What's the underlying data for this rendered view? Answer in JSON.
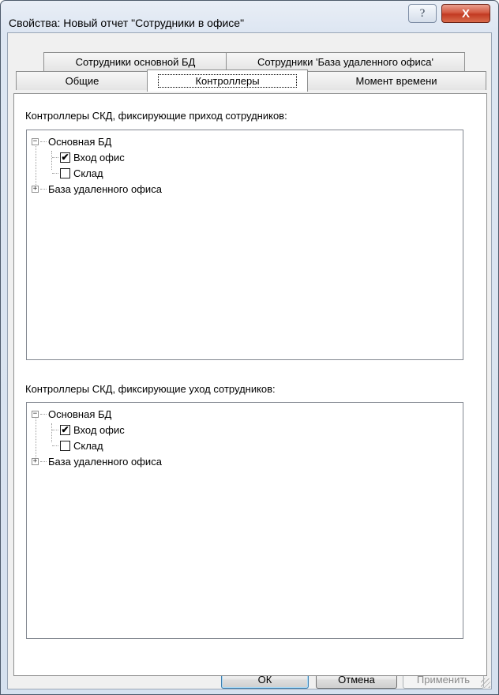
{
  "window": {
    "title": "Свойства: Новый отчет \"Сотрудники в офисе\"",
    "help_glyph": "?",
    "close_glyph": "X"
  },
  "tabs_row1": [
    {
      "label": "Сотрудники основной БД"
    },
    {
      "label": "Сотрудники 'База удаленного офиса'"
    }
  ],
  "tabs_row2": [
    {
      "label": "Общие"
    },
    {
      "label": "Контроллеры",
      "active": true
    },
    {
      "label": "Момент времени"
    }
  ],
  "entry_group": {
    "label": "Контроллеры СКД, фиксирующие приход сотрудников:",
    "tree": [
      {
        "label": "Основная БД",
        "expanded": true,
        "expander": "−"
      },
      {
        "label": "Вход офис",
        "checked": true,
        "check": "✔"
      },
      {
        "label": "Склад",
        "checked": false,
        "check": ""
      },
      {
        "label": "База удаленного офиса",
        "expanded": false,
        "expander": "+"
      }
    ]
  },
  "exit_group": {
    "label": "Контроллеры СКД, фиксирующие уход сотрудников:",
    "tree": [
      {
        "label": "Основная БД",
        "expanded": true,
        "expander": "−"
      },
      {
        "label": "Вход офис",
        "checked": true,
        "check": "✔"
      },
      {
        "label": "Склад",
        "checked": false,
        "check": ""
      },
      {
        "label": "База удаленного офиса",
        "expanded": false,
        "expander": "+"
      }
    ]
  },
  "buttons": {
    "ok": "ОК",
    "cancel": "Отмена",
    "apply": "Применить",
    "apply_enabled": false
  }
}
